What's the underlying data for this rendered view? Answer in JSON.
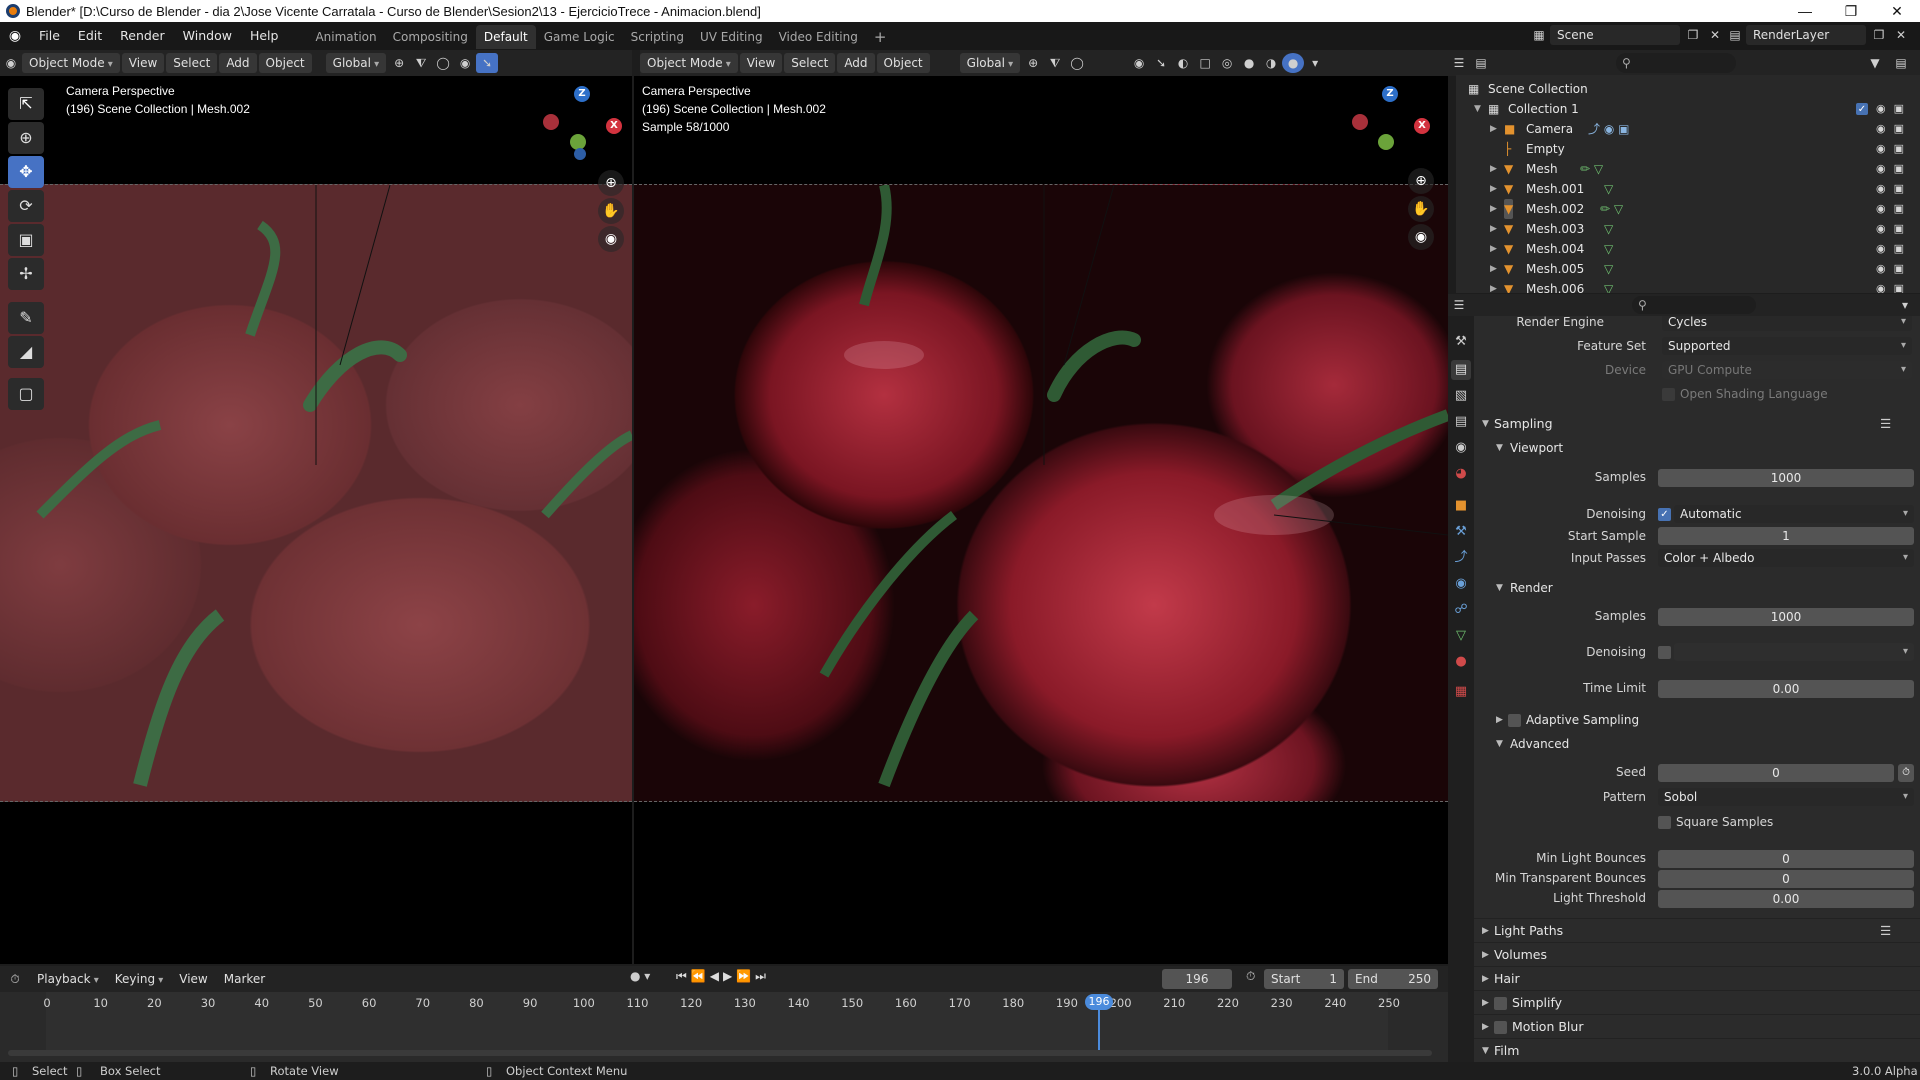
{
  "title": "Blender* [D:\\Curso de Blender - dia 2\\Jose Vicente Carratala - Curso de Blender\\Sesion2\\13 - EjercicioTrece - Animacion.blend]",
  "menu": [
    "File",
    "Edit",
    "Render",
    "Window",
    "Help"
  ],
  "workspaces": [
    "Animation",
    "Compositing",
    "Default",
    "Game Logic",
    "Scripting",
    "UV Editing",
    "Video Editing"
  ],
  "active_workspace": "Default",
  "scene": {
    "name": "Scene",
    "layer": "RenderLayer"
  },
  "viewport_header": {
    "mode": "Object Mode",
    "view": "View",
    "select": "Select",
    "add": "Add",
    "object": "Object",
    "orientation": "Global"
  },
  "viewport_left": {
    "line1": "Camera Perspective",
    "line2": "(196) Scene Collection | Mesh.002"
  },
  "viewport_right": {
    "line1": "Camera Perspective",
    "line2": "(196) Scene Collection | Mesh.002",
    "line3": "Sample 58/1000"
  },
  "gizmo": {
    "z": "Z",
    "x": "X"
  },
  "outliner": {
    "root": "Scene Collection",
    "collection": "Collection 1",
    "items": [
      "Camera",
      "Empty",
      "Mesh",
      "Mesh.001",
      "Mesh.002",
      "Mesh.003",
      "Mesh.004",
      "Mesh.005",
      "Mesh.006"
    ]
  },
  "properties": {
    "render_engine_label": "Render Engine",
    "render_engine": "Cycles",
    "feature_set_label": "Feature Set",
    "feature_set": "Supported",
    "device_label": "Device",
    "device": "GPU Compute",
    "osl": "Open Shading Language",
    "sampling": "Sampling",
    "viewport": "Viewport",
    "samples_label": "Samples",
    "vp_samples": "1000",
    "denoising_label": "Denoising",
    "vp_denoiser": "Automatic",
    "start_sample_label": "Start Sample",
    "start_sample": "1",
    "input_passes_label": "Input Passes",
    "input_passes": "Color + Albedo",
    "render": "Render",
    "r_samples": "1000",
    "time_limit_label": "Time Limit",
    "time_limit": "0.00",
    "adaptive": "Adaptive Sampling",
    "advanced": "Advanced",
    "seed_label": "Seed",
    "seed": "0",
    "pattern_label": "Pattern",
    "pattern": "Sobol",
    "square": "Square Samples",
    "min_light_label": "Min Light Bounces",
    "min_light": "0",
    "min_transp_label": "Min Transparent Bounces",
    "min_transp": "0",
    "light_thr_label": "Light Threshold",
    "light_thr": "0.00",
    "sections": [
      "Light Paths",
      "Volumes",
      "Hair",
      "Simplify",
      "Motion Blur",
      "Film"
    ]
  },
  "timeline": {
    "playback": "Playback",
    "keying": "Keying",
    "view": "View",
    "marker": "Marker",
    "current": "196",
    "start_label": "Start",
    "start": "1",
    "end_label": "End",
    "end": "250",
    "ticks": [
      "0",
      "10",
      "20",
      "30",
      "40",
      "50",
      "60",
      "70",
      "80",
      "90",
      "100",
      "110",
      "120",
      "130",
      "140",
      "150",
      "160",
      "170",
      "180",
      "190",
      "200",
      "210",
      "220",
      "230",
      "240",
      "250"
    ]
  },
  "status": {
    "select": "Select",
    "box_select": "Box Select",
    "rotate": "Rotate View",
    "context": "Object Context Menu",
    "version": "3.0.0 Alpha"
  }
}
